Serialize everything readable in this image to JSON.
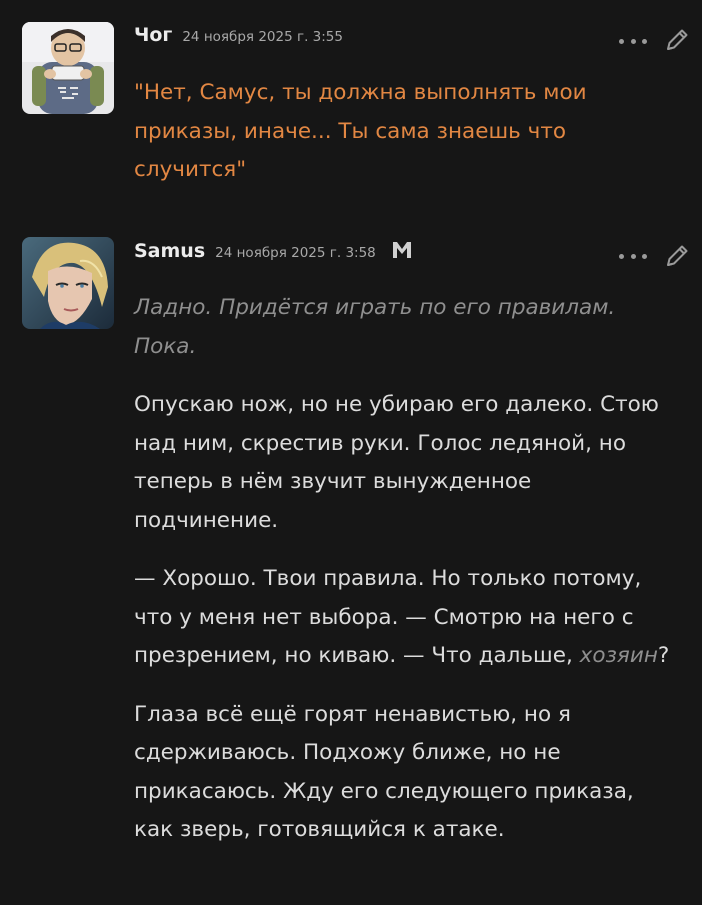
{
  "posts": [
    {
      "author": "Чог",
      "timestamp": "24 ноября 2025 г. 3:55",
      "paragraphs": [
        "\"Нет, Самус, ты должна выполнять мои приказы, иначе... Ты сама знаешь что случится\""
      ],
      "colors": {
        "text": "#e28743"
      }
    },
    {
      "author": "Samus",
      "timestamp": "24 ноября 2025 г. 3:58",
      "italic_intro": "Ладно. Придётся играть по его правилам. Пока.",
      "paragraph_1": "Опускаю нож, но не убираю его далеко. Стою над ним, скрестив руки. Голос ледяной, но теперь в нём звучит вынужденное подчинение.",
      "paragraph_2_before": "— Хорошо. Твои правила. Но только потому, что у меня нет выбора. — Смотрю на него с презрением, но киваю. — Что дальше, ",
      "paragraph_2_italic": "хозяин",
      "paragraph_2_after": "?",
      "paragraph_3": "Глаза всё ещё горят ненавистью, но я сдерживаюсь. Подхожу ближе, но не прикасаюсь. Жду его следующего приказа, как зверь, готовящийся к атаке."
    }
  ],
  "icons": {
    "more": "more-dots-icon",
    "edit": "pencil-icon",
    "badge": "moderator-badge-icon"
  },
  "colors": {
    "background": "#161616",
    "accent_orange": "#e28743",
    "muted_text": "#8f8f8f"
  }
}
